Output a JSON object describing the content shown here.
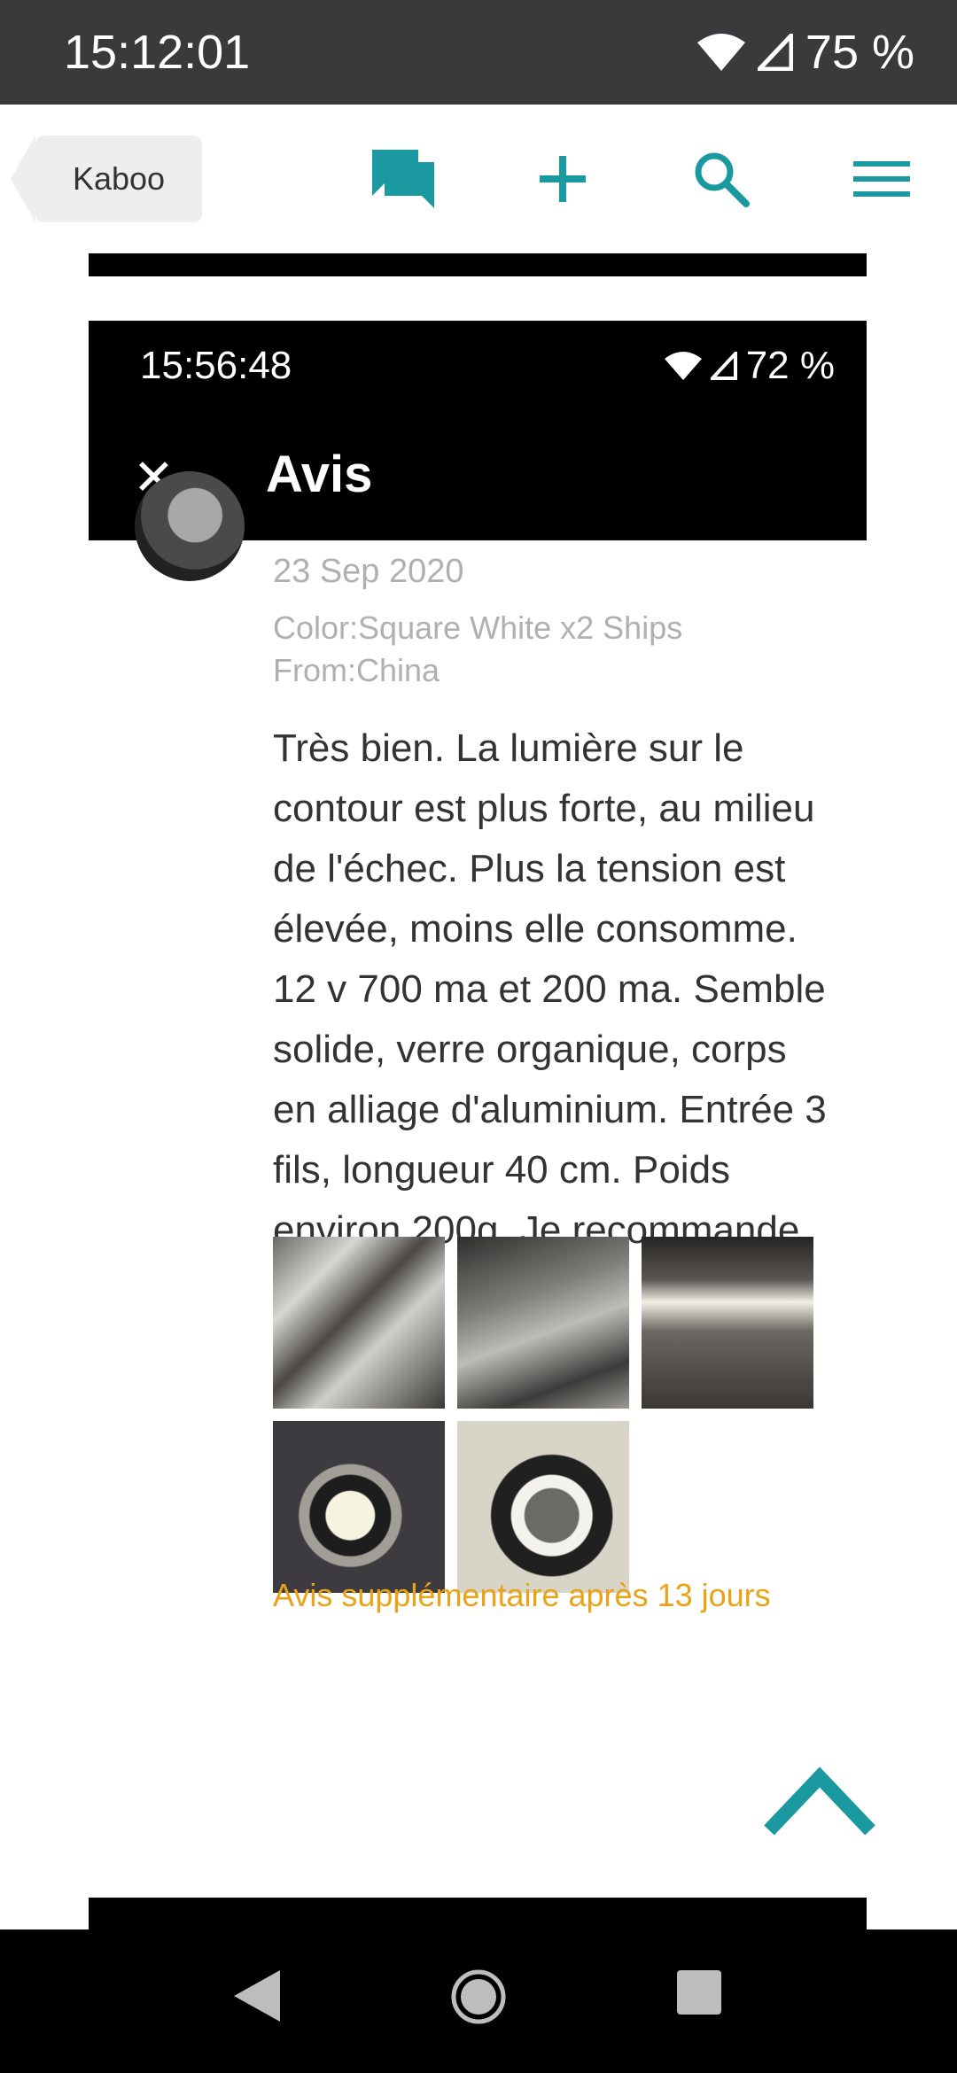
{
  "status_bar": {
    "time": "15:12:01",
    "battery": "75 %"
  },
  "app_bar": {
    "back_label": "Kaboo",
    "icons": [
      "chat-icon",
      "add-icon",
      "search-icon",
      "menu-icon"
    ],
    "accent_color": "#1a9aa0"
  },
  "screenshot": {
    "status_time": "15:56:48",
    "status_battery": "72 %",
    "header_title": "Avis",
    "review": {
      "date": "23 Sep 2020",
      "variant": "Color:Square White x2 Ships From:China",
      "body": "Très bien. La lumière sur le contour est plus forte, au milieu de l'échec. Plus la tension est élevée, moins elle consomme. 12 v 700 ma et 200 ma. Semble solide, verre organique, corps en alliage d'aluminium. Entrée 3 fils, longueur 40 cm. Poids environ 200g. Je recommande.",
      "photos": [
        "photo-1",
        "photo-2",
        "photo-3",
        "photo-4",
        "photo-5"
      ],
      "additional_review": "Avis supplémentaire après 13 jours"
    }
  },
  "nav_bar": {
    "icons": [
      "back-icon",
      "home-icon",
      "recents-icon"
    ]
  }
}
